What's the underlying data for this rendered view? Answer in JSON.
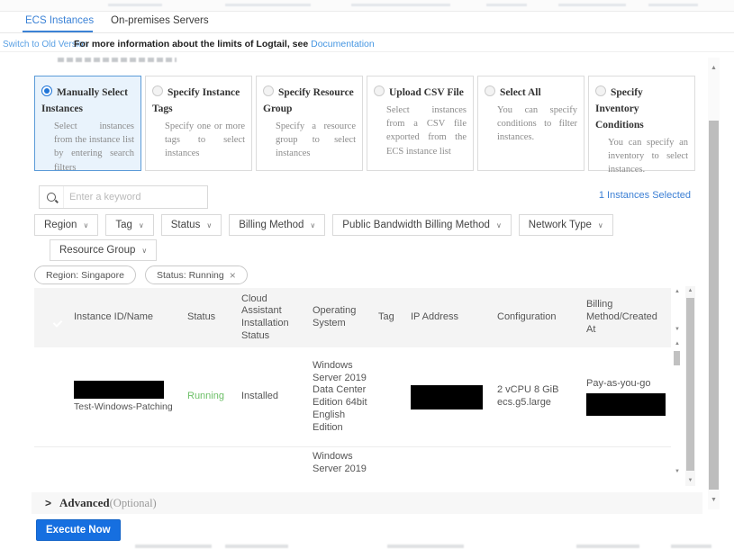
{
  "tabs": [
    {
      "label": "ECS Instances",
      "active": true
    },
    {
      "label": "On-premises Servers",
      "active": false
    }
  ],
  "subheader": {
    "switch_link": "Switch to Old Version",
    "info_text": "For more information about the limits of Logtail, see ",
    "doc_link": "Documentation"
  },
  "selection_modes": [
    {
      "title": "Manually Select Instances",
      "description": "Select instances from the instance list by entering search filters",
      "selected": true
    },
    {
      "title": "Specify Instance Tags",
      "description": "Specify one or more tags to select instances",
      "selected": false
    },
    {
      "title": "Specify Resource Group",
      "description": "Specify a resource group to select instances",
      "selected": false
    },
    {
      "title": "Upload CSV File",
      "description": "Select instances from a CSV file exported from the ECS instance list",
      "selected": false
    },
    {
      "title": "Select All",
      "description": "You can specify conditions to filter instances.",
      "selected": false
    },
    {
      "title": "Specify Inventory Conditions",
      "description": "You can specify an inventory to select instances.",
      "selected": false
    }
  ],
  "search": {
    "placeholder": "Enter a keyword"
  },
  "selected_count_text": "1 Instances Selected",
  "filters": {
    "row1": [
      "Region",
      "Tag",
      "Status",
      "Billing Method",
      "Public Bandwidth Billing Method",
      "Network Type"
    ],
    "row2": [
      "Resource Group"
    ]
  },
  "active_filters": [
    {
      "label": "Region: Singapore",
      "removable": false
    },
    {
      "label": "Status: Running",
      "removable": true
    }
  ],
  "table": {
    "columns": [
      "Instance ID/Name",
      "Status",
      "Cloud Assistant Installation Status",
      "Operating System",
      "Tag",
      "IP Address",
      "Configuration",
      "Billing Method/Created At"
    ],
    "select_all_checked": true,
    "rows": [
      {
        "checked": true,
        "id_redacted": true,
        "name": "Test-Windows-Patching",
        "status": "Running",
        "cloud_assistant": "Installed",
        "os": "Windows Server 2019 Data Center Edition 64bit English Edition",
        "tag": "",
        "ip_redacted": true,
        "configuration_line1": "2 vCPU 8 GiB",
        "configuration_line2": "ecs.g5.large",
        "billing_method": "Pay-as-you-go",
        "created_at_redacted": true
      },
      {
        "os": "Windows Server 2019"
      }
    ]
  },
  "advanced": {
    "label": "Advanced",
    "optional": "(Optional)"
  },
  "execute_button": "Execute Now",
  "icons": {
    "chevron_down": "∨",
    "chevron_right": ">",
    "close": "×",
    "scroll_up": "▲",
    "scroll_down": "▼"
  },
  "colors": {
    "accent_blue": "#166fe0",
    "link_blue": "#4596e2",
    "tab_blue": "#3b82d6",
    "running_green": "#6cbf67",
    "selected_card_bg": "#e9f3fc",
    "selected_card_border": "#5b9bd8",
    "redaction_black": "#000000"
  }
}
